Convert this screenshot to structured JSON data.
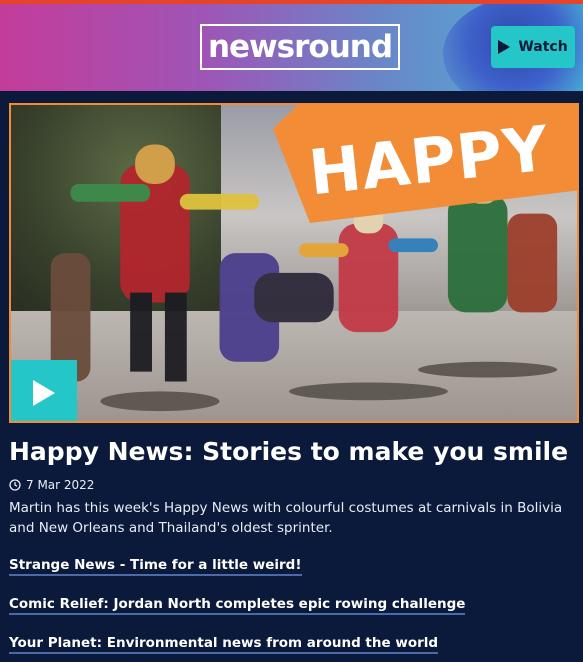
{
  "header": {
    "logo_text": "newsround",
    "watch_label": "Watch"
  },
  "video": {
    "overlay_text": "HAPPY",
    "play_icon": "play-icon"
  },
  "article": {
    "title": "Happy News: Stories to make you smile",
    "date": "7 Mar 2022",
    "summary": "Martin has this week's Happy News with colourful costumes at carnivals in Bolivia and New Orleans and Thailand's oldest sprinter."
  },
  "links": [
    {
      "label": "Strange News - Time for a little weird!"
    },
    {
      "label": "Comic Relief: Jordan North completes epic rowing challenge"
    },
    {
      "label": "Your Planet: Environmental news from around the world"
    }
  ],
  "colors": {
    "page_background": "#0b1a3a",
    "accent_teal": "#24c6c8",
    "accent_orange": "#f28c37",
    "top_border": "#e5432a"
  }
}
